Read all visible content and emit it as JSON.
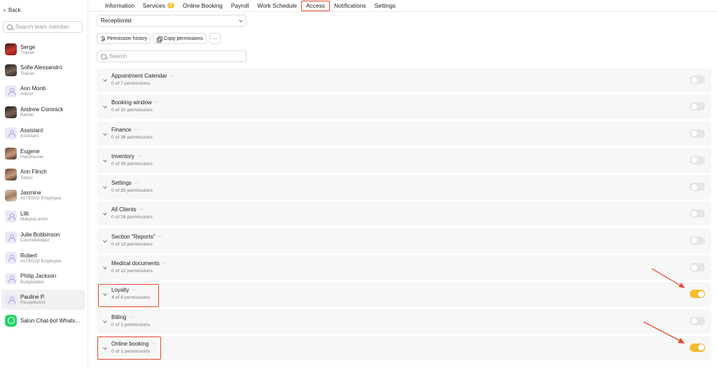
{
  "sidebar": {
    "back_label": "Back",
    "search_placeholder": "Search team member",
    "members": [
      {
        "name": "Serge",
        "role": "Trainer",
        "avatar": "photo-red"
      },
      {
        "name": "Sofie Alessandro",
        "role": "Trainer",
        "avatar": "photo-dark"
      },
      {
        "name": "Ann Monti",
        "role": "Admin",
        "avatar": "placeholder"
      },
      {
        "name": "Andrew Comrack",
        "role": "Barber",
        "avatar": "photo-dark"
      },
      {
        "name": "Assistant",
        "role": "Assistant",
        "avatar": "placeholder"
      },
      {
        "name": "Eugene",
        "role": "Hairdresser",
        "avatar": "photo"
      },
      {
        "name": "Ann Flinch",
        "role": "Tattoo",
        "avatar": "photo"
      },
      {
        "name": "Jasmine",
        "role": "ALTEGIO Employee",
        "avatar": "photo-light"
      },
      {
        "name": "Lilit",
        "role": "Makeup artist",
        "avatar": "placeholder"
      },
      {
        "name": "Julie Bobbinson",
        "role": "Cosmetologist",
        "avatar": "placeholder"
      },
      {
        "name": "Robert",
        "role": "ALTEGIO Employee",
        "avatar": "placeholder"
      },
      {
        "name": "Philip Jackson",
        "role": "Bodybuilder",
        "avatar": "placeholder"
      },
      {
        "name": "Pauline P.",
        "role": "Receptionist",
        "avatar": "placeholder",
        "active": true
      },
      {
        "name": "Salon Chat-bot Whats...",
        "role": "",
        "avatar": "whatsapp"
      }
    ]
  },
  "nav": {
    "tabs": [
      {
        "label": "Information"
      },
      {
        "label": "Services",
        "badge": "1"
      },
      {
        "label": "Online Booking"
      },
      {
        "label": "Payroll"
      },
      {
        "label": "Work Schedule"
      },
      {
        "label": "Access",
        "active": true
      },
      {
        "label": "Notifications"
      },
      {
        "label": "Settings"
      }
    ]
  },
  "content": {
    "role_value": "Receptionist",
    "permission_history_label": "Permission history",
    "copy_permissions_label": "Copy permissions",
    "more_label": "···",
    "search_placeholder": "Search",
    "sections": [
      {
        "title": "Appointment Calendar",
        "count": "0 of 7 permissions",
        "enabled": false
      },
      {
        "title": "Booking window",
        "count": "0 of 31 permissions",
        "enabled": false
      },
      {
        "title": "Finance",
        "count": "0 of 36 permissions",
        "enabled": false
      },
      {
        "title": "Inventory",
        "count": "0 of 39 permissions",
        "enabled": false
      },
      {
        "title": "Settings",
        "count": "0 of 35 permissions",
        "enabled": false
      },
      {
        "title": "All Clients",
        "count": "0 of 26 permissions",
        "enabled": false
      },
      {
        "title": "Section \"Reports\"",
        "count": "0 of 13 permissions",
        "enabled": false
      },
      {
        "title": "Medical documents",
        "count": "0 of 12 permissions",
        "enabled": false
      },
      {
        "title": "Loyalty",
        "count": "4 of 8 permissions",
        "enabled": true
      },
      {
        "title": "Billing",
        "count": "0 of 1 permissions",
        "enabled": false
      },
      {
        "title": "Online booking",
        "count": "0 of 1 permissions",
        "enabled": true
      }
    ],
    "section_dots": "···"
  },
  "colors": {
    "accent_toggle": "#f2bd2f",
    "highlight": "#e8492a",
    "badge": "#f6c444"
  }
}
